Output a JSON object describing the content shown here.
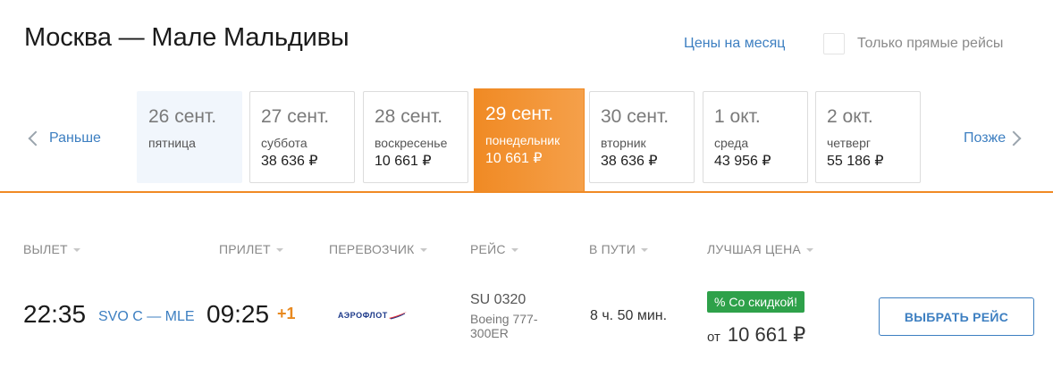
{
  "header": {
    "title": "Москва — Мале Мальдивы",
    "month_prices_link": "Цены на месяц",
    "direct_only_label": "Только прямые рейсы",
    "direct_only_checked": false
  },
  "date_nav": {
    "prev_label": "Раньше",
    "next_label": "Позже",
    "days": [
      {
        "date": "26 сент.",
        "weekday": "пятница",
        "price": "",
        "state": "past"
      },
      {
        "date": "27 сент.",
        "weekday": "суббота",
        "price": "38 636 ₽",
        "state": "normal"
      },
      {
        "date": "28 сент.",
        "weekday": "воскресенье",
        "price": "10 661 ₽",
        "state": "normal"
      },
      {
        "date": "29 сент.",
        "weekday": "понедельник",
        "price": "10 661 ₽",
        "state": "active"
      },
      {
        "date": "30 сент.",
        "weekday": "вторник",
        "price": "38 636 ₽",
        "state": "normal"
      },
      {
        "date": "1 окт.",
        "weekday": "среда",
        "price": "43 956 ₽",
        "state": "normal"
      },
      {
        "date": "2 окт.",
        "weekday": "четверг",
        "price": "55 186 ₽",
        "state": "normal"
      }
    ]
  },
  "columns": {
    "departure": "ВЫЛЕТ",
    "arrival": "ПРИЛЕТ",
    "carrier": "ПЕРЕВОЗЧИК",
    "flight": "РЕЙС",
    "duration": "В ПУТИ",
    "best_price": "ЛУЧШАЯ ЦЕНА"
  },
  "flight": {
    "departure_time": "22:35",
    "route": "SVO C — MLE",
    "arrival_time": "09:25",
    "day_offset": "+1",
    "carrier_logo_text": "АЭРОФЛОТ",
    "flight_number": "SU 0320",
    "aircraft": "Boeing 777-300ER",
    "duration": "8 ч. 50 мин.",
    "discount_badge": "% Со скидкой!",
    "price_prefix": "от",
    "price": "10 661 ₽",
    "select_button": "ВЫБРАТЬ РЕЙС"
  },
  "colors": {
    "accent_orange": "#f08a24",
    "link_blue": "#3d7fc1",
    "badge_green": "#2ea14a"
  }
}
